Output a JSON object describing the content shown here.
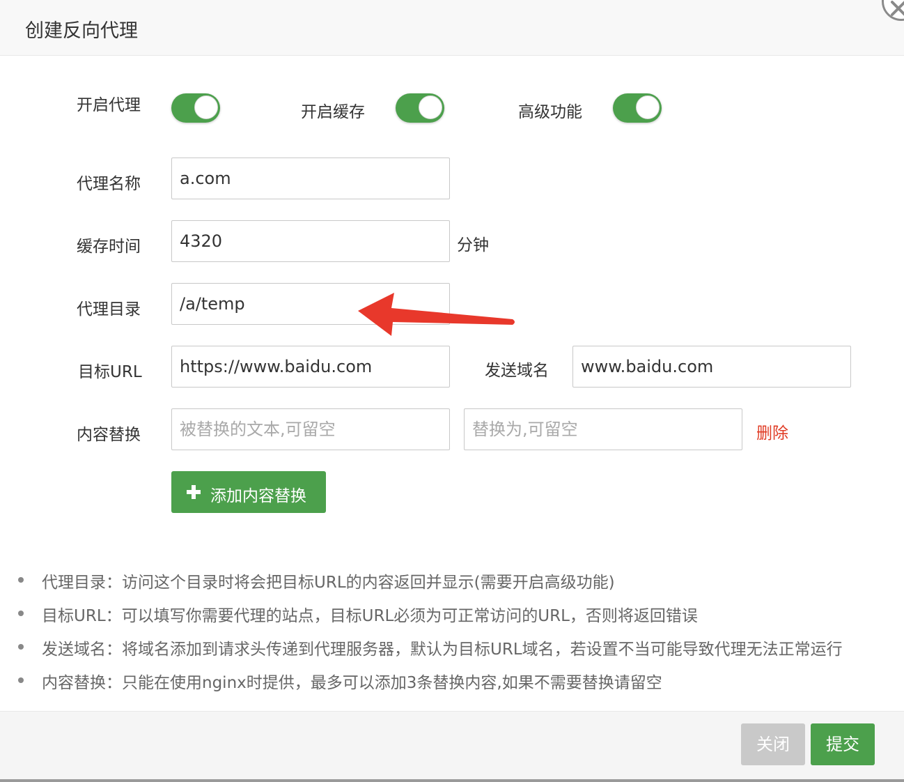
{
  "dialog": {
    "title": "创建反向代理",
    "close_icon": "close-icon"
  },
  "toggles": [
    {
      "label": "开启代理",
      "on": true
    },
    {
      "label": "开启缓存",
      "on": true
    },
    {
      "label": "高级功能",
      "on": true
    }
  ],
  "form": {
    "proxy_name": {
      "label": "代理名称",
      "value": "a.com"
    },
    "cache_time": {
      "label": "缓存时间",
      "value": "4320",
      "unit": "分钟"
    },
    "proxy_dir": {
      "label": "代理目录",
      "value": "/a/temp"
    },
    "target_url": {
      "label": "目标URL",
      "value": "https://www.baidu.com"
    },
    "send_domain": {
      "label": "发送域名",
      "value": "www.baidu.com"
    },
    "replace": {
      "label": "内容替换",
      "from_placeholder": "被替换的文本,可留空",
      "to_placeholder": "替换为,可留空",
      "delete_label": "删除"
    },
    "add_replace_label": "添加内容替换"
  },
  "notes": [
    "代理目录：访问这个目录时将会把目标URL的内容返回并显示(需要开启高级功能)",
    "目标URL：可以填写你需要代理的站点，目标URL必须为可正常访问的URL，否则将返回错误",
    "发送域名：将域名添加到请求头传递到代理服务器，默认为目标URL域名，若设置不当可能导致代理无法正常运行",
    "内容替换：只能在使用nginx时提供，最多可以添加3条替换内容,如果不需要替换请留空"
  ],
  "footer": {
    "close_label": "关闭",
    "submit_label": "提交"
  },
  "colors": {
    "primary": "#4ca04c",
    "danger": "#e03b24",
    "annotation_arrow": "#e8382b",
    "disabled": "#c9c9c9"
  }
}
